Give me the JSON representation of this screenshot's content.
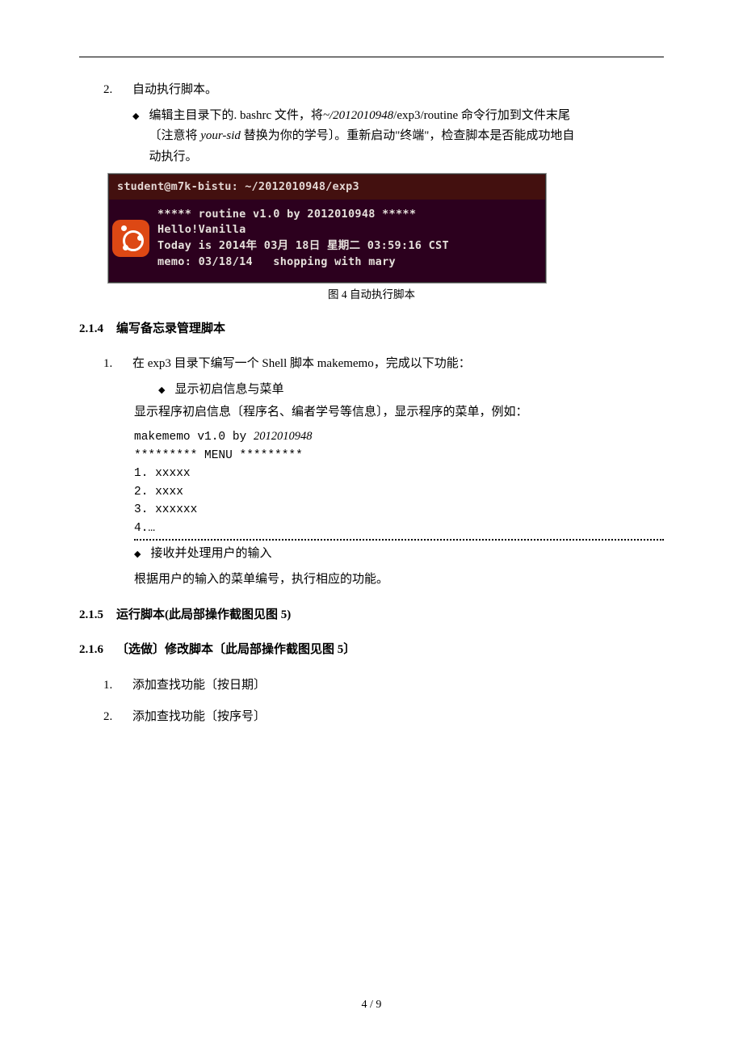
{
  "top": {
    "item2_num": "2.",
    "item2_text": "自动执行脚本。",
    "bullet_text_1": "编辑主目录下的. bashrc 文件，将",
    "bullet_cmd_prefix": "~/",
    "bullet_cmd_sid": "2012010948",
    "bullet_cmd_suffix": "/exp3/routine 命令行加到文件末尾",
    "bullet_text_2a": "〔注意将 ",
    "bullet_text_2_italic": "your-sid",
    "bullet_text_2b": " 替换为你的学号〕。重新启动\"终端\"，检查脚本是否能成功地自",
    "bullet_text_3": "动执行。"
  },
  "terminal": {
    "title": "student@m7k-bistu: ~/2012010948/exp3",
    "line1": "***** routine v1.0 by 2012010948 *****",
    "line2": "Hello!Vanilla",
    "line3": "Today is 2014年 03月 18日 星期二 03:59:16 CST",
    "line4": "memo: 03/18/14   shopping with mary"
  },
  "caption1": "图 4 自动执行脚本",
  "s214": {
    "num": "2.1.4",
    "title": "编写备忘录管理脚本",
    "item1_num": "1.",
    "item1_text": "在 exp3 目录下编写一个 Shell 脚本 makememo，完成以下功能：",
    "bullet1": "显示初启信息与菜单",
    "para1": "显示程序初启信息〔程序名、编者学号等信息〕，显示程序的菜单，例如：",
    "menu_line1_a": "makememo v1.0 by ",
    "menu_line1_b": "2012010948",
    "menu_line2": "********* MENU *********",
    "menu_line3": "1. xxxxx",
    "menu_line4": "2. xxxx",
    "menu_line5": "3. xxxxxx",
    "menu_line6": "4.…",
    "bullet2": "接收并处理用户的输入",
    "para2": "根据用户的输入的菜单编号，执行相应的功能。"
  },
  "s215": {
    "num": "2.1.5",
    "title": "运行脚本(此局部操作截图见图 5)"
  },
  "s216": {
    "num": "2.1.6",
    "title": "〔选做〕修改脚本〔此局部操作截图见图 5〕",
    "item1_num": "1.",
    "item1_text": "添加查找功能〔按日期〕",
    "item2_num": "2.",
    "item2_text": "添加查找功能〔按序号〕"
  },
  "pagenum": "4 / 9"
}
